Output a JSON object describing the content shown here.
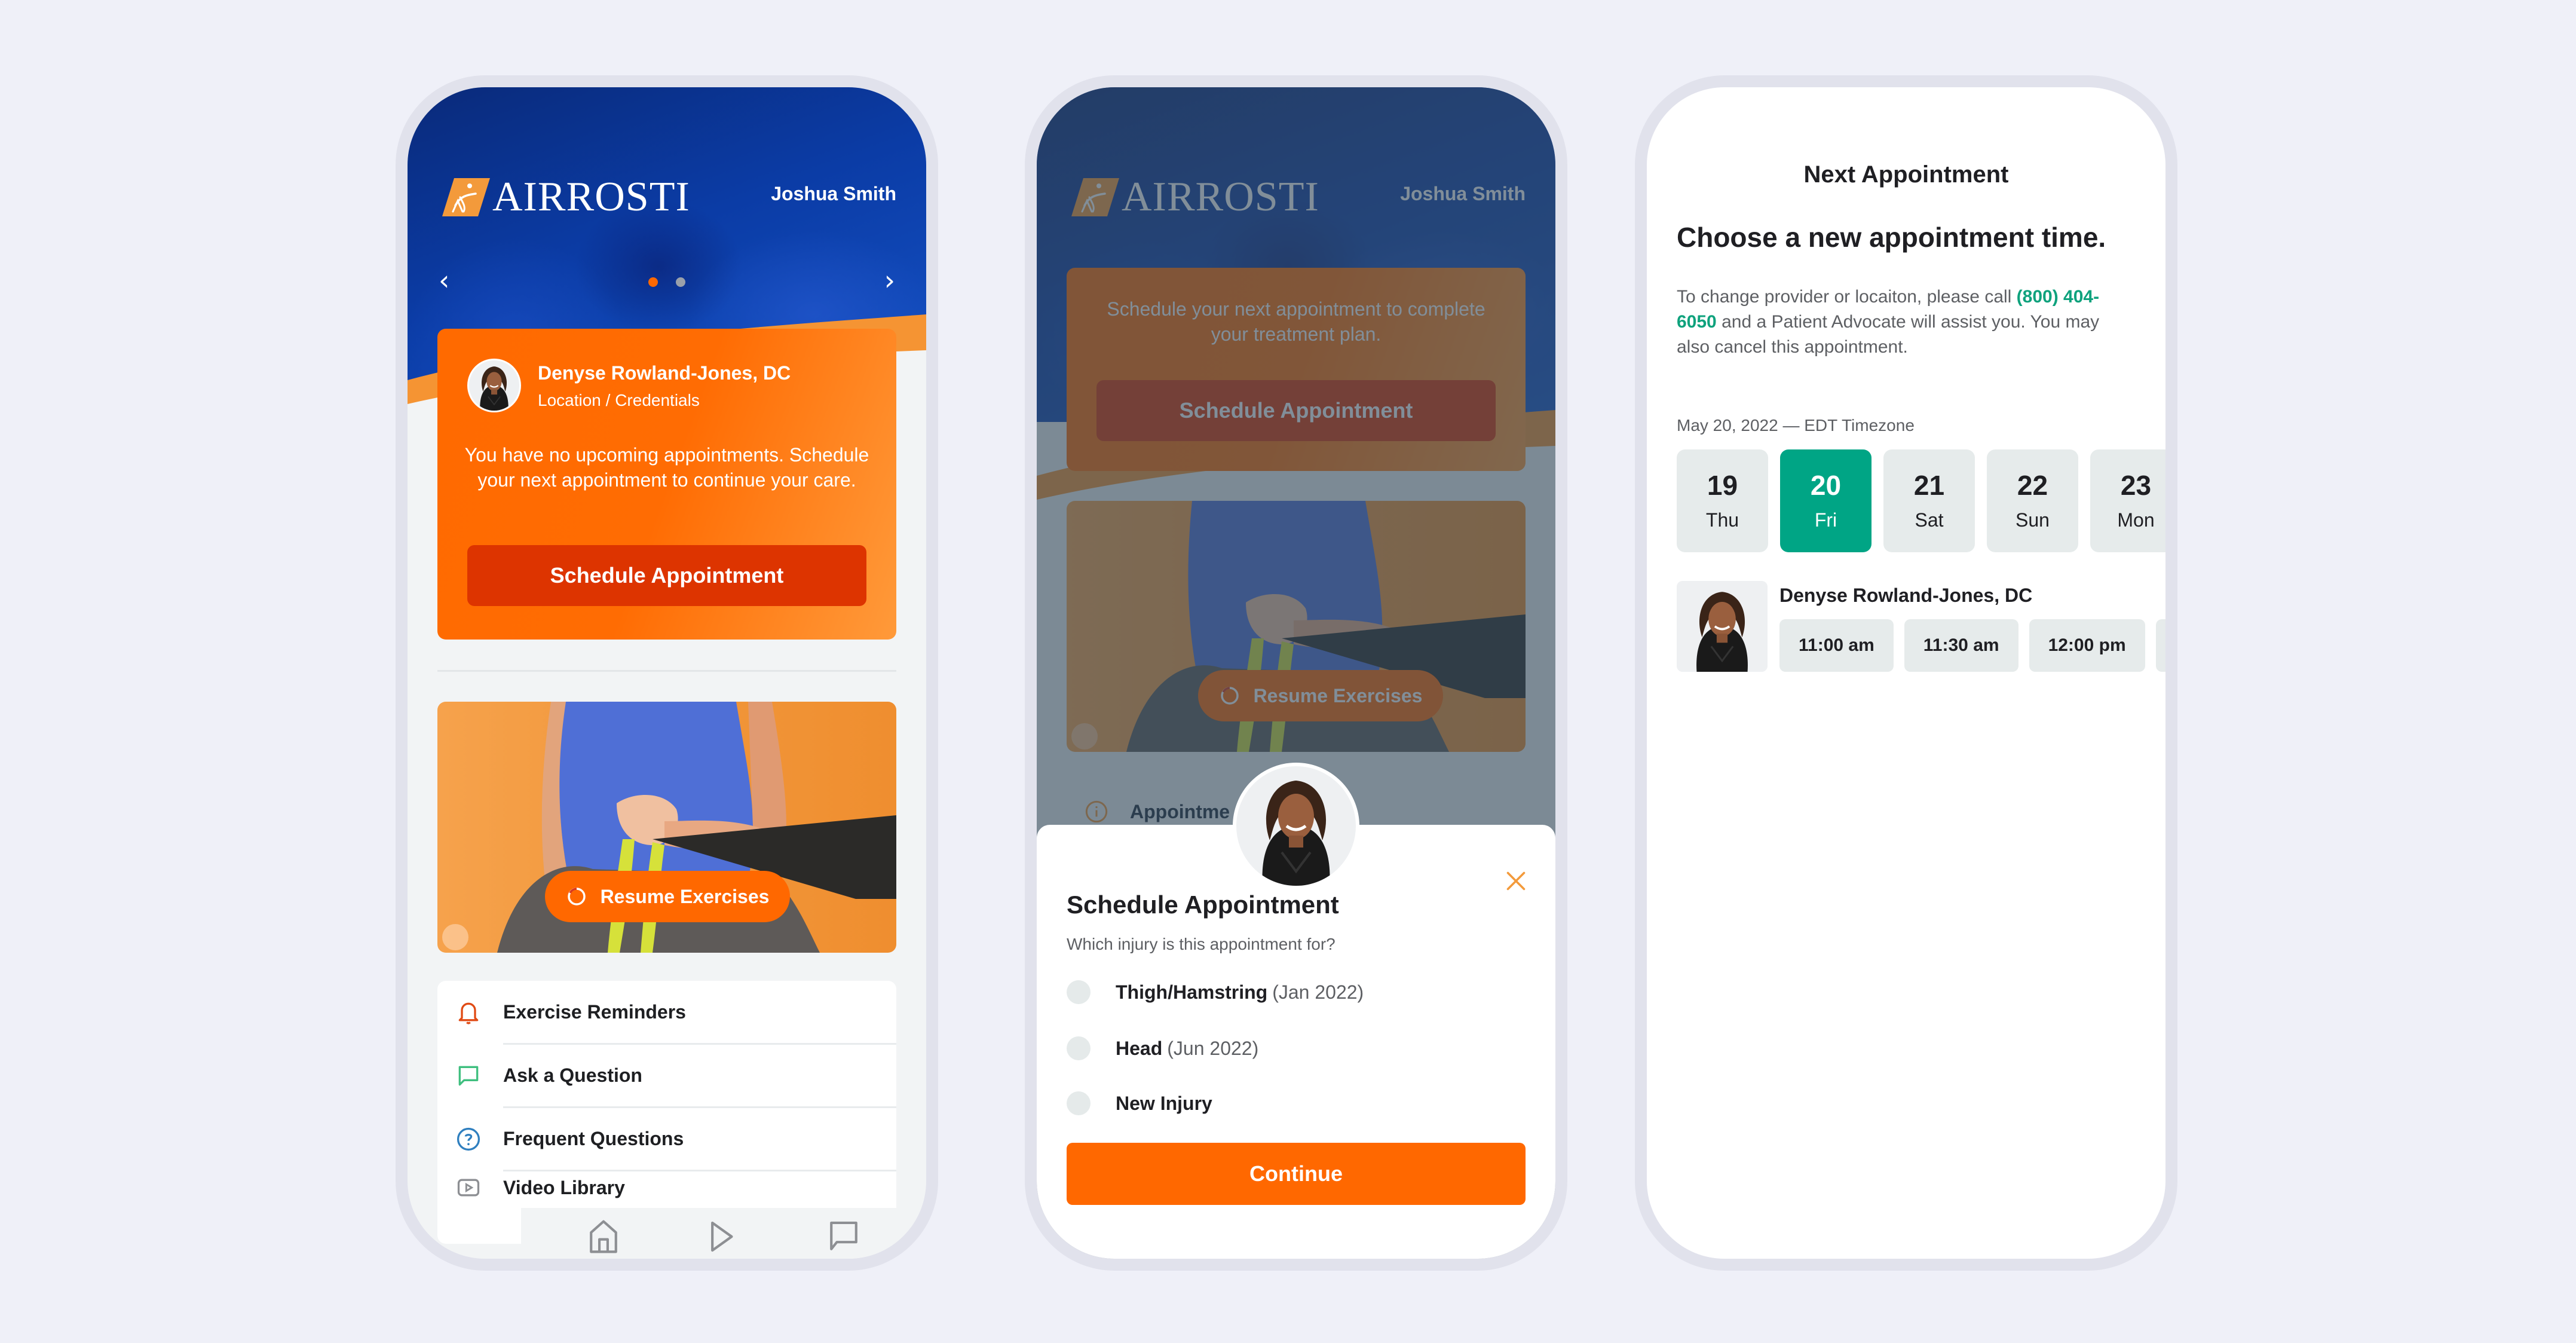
{
  "brand": {
    "name": "AIRROSTI",
    "colors": {
      "orange": "#ff6800",
      "orange_dark": "#dd3400",
      "blue": "#0b3ca6",
      "teal": "#00a585",
      "background": "#eff0f8"
    }
  },
  "home_screen": {
    "user_name": "Joshua Smith",
    "carousel": {
      "prev_icon": "chevron-left-icon",
      "next_icon": "chevron-right-icon",
      "total_slides": 2,
      "active_slide": 1
    },
    "provider_card": {
      "provider_name": "Denyse Rowland-Jones, DC",
      "credentials": "Location / Credentials",
      "message": "You have no upcoming appointments. Schedule your next appointment to continue your care.",
      "button_label": "Schedule Appointment"
    },
    "exercise_card": {
      "button_label": "Resume Exercises"
    },
    "menu": [
      {
        "label": "Exercise Reminders",
        "icon": "bell-icon"
      },
      {
        "label": "Ask a Question",
        "icon": "chat-bubble-icon"
      },
      {
        "label": "Frequent Questions",
        "icon": "question-circle-icon"
      },
      {
        "label": "Video Library",
        "icon": "video-play-icon"
      }
    ],
    "bottom_nav": [
      {
        "icon": "home-icon"
      },
      {
        "icon": "play-icon"
      },
      {
        "icon": "message-icon"
      }
    ]
  },
  "schedule_modal_screen": {
    "user_name": "Joshua Smith",
    "background_card": {
      "message": "Schedule your next appointment to complete your treatment plan.",
      "button_label": "Schedule Appointment"
    },
    "background_exercise_button": "Resume Exercises",
    "background_row_label": "Appointme",
    "modal": {
      "title": "Schedule Appointment",
      "subtitle": "Which injury is this appointment for?",
      "options": [
        {
          "label": "Thigh/Hamstring",
          "date": "(Jan 2022)",
          "selected": false
        },
        {
          "label": "Head",
          "date": "(Jun 2022)",
          "selected": false
        },
        {
          "label": "New Injury",
          "date": "",
          "selected": false
        }
      ],
      "continue_label": "Continue"
    }
  },
  "next_appointment_screen": {
    "title": "Next Appointment",
    "heading": "Choose a new appointment time.",
    "body_before_phone": "To change provider or locaiton, please call ",
    "phone_number": "(800) 404-6050",
    "body_after_phone": " and a Patient Advocate will assist you. You may also cancel this appointment.",
    "date_label": "May 20, 2022 — EDT Timezone",
    "dates": [
      {
        "day": "19",
        "weekday": "Thu",
        "selected": false
      },
      {
        "day": "20",
        "weekday": "Fri",
        "selected": true
      },
      {
        "day": "21",
        "weekday": "Sat",
        "selected": false
      },
      {
        "day": "22",
        "weekday": "Sun",
        "selected": false
      },
      {
        "day": "23",
        "weekday": "Mon",
        "selected": false
      }
    ],
    "provider_name": "Denyse Rowland-Jones, DC",
    "time_slots": [
      "11:00 am",
      "11:30 am",
      "12:00 pm"
    ]
  }
}
